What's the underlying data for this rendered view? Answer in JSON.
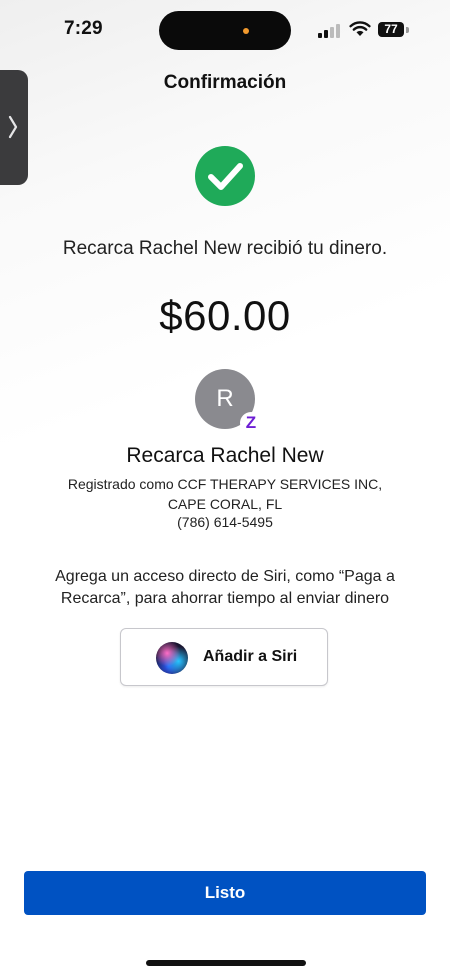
{
  "status_bar": {
    "time": "7:29",
    "battery": "77",
    "icons": [
      "signal-icon",
      "wifi-icon",
      "battery-icon"
    ]
  },
  "header": {
    "title": "Confirmación"
  },
  "confirmation": {
    "status_icon": "check-circle-icon",
    "message": "Recarca Rachel New recibió tu dinero.",
    "amount": "$60.00"
  },
  "recipient": {
    "avatar_initial": "R",
    "badge_icon": "zelle-icon",
    "badge_glyph": "Z",
    "name": "Recarca Rachel New",
    "registration": "Registrado como CCF THERAPY SERVICES INC, CAPE CORAL, FL",
    "phone": "(786) 614-5495"
  },
  "siri": {
    "prompt": "Agrega un acceso directo de Siri, como “Paga a Recarca”, para ahorrar tiempo al enviar dinero",
    "button_label": "Añadir a Siri",
    "icon": "siri-icon"
  },
  "footer": {
    "done_label": "Listo"
  },
  "colors": {
    "primary": "#0052c2",
    "success": "#1faa59",
    "avatar": "#8a8a8f",
    "zelle": "#6d1ed4"
  }
}
